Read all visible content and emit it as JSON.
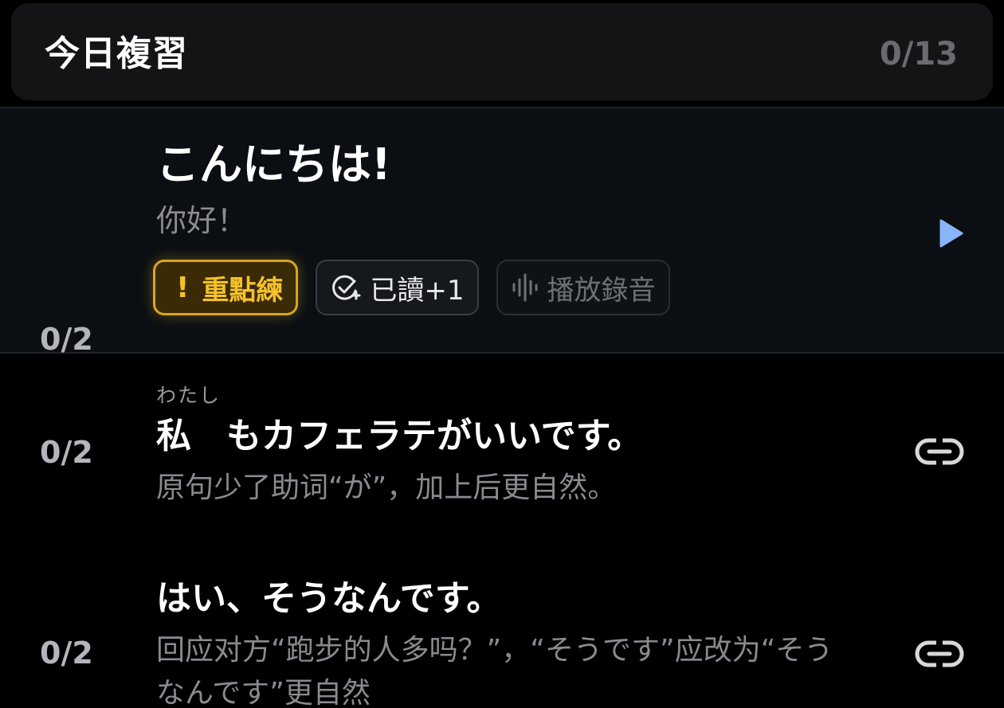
{
  "header": {
    "title": "今日複習",
    "progress": "0/13"
  },
  "items": [
    {
      "score": "0/2",
      "japanese": "こんにちは!",
      "translation": "你好！",
      "tags": {
        "highlight_label": "重點練",
        "highlight_icon": "!",
        "read_label": "已讀+1",
        "record_label": "播放錄音"
      },
      "action_icon": "play-icon"
    },
    {
      "score": "0/2",
      "ruby": "わたし",
      "japanese": "私　もカフェラテがいいです。",
      "note": "原句少了助词“が”，加上后更自然。",
      "action_icon": "link-icon"
    },
    {
      "score": "0/2",
      "japanese": "はい、そうなんです。",
      "note": "回应对方“跑步的人多吗？”，“そうです”应改为“そうなんです”更自然",
      "action_icon": "link-icon"
    }
  ],
  "colors": {
    "accent_blue": "#8ab4f8",
    "highlight_yellow": "#f5c12a",
    "muted_text": "#8a8a90"
  }
}
